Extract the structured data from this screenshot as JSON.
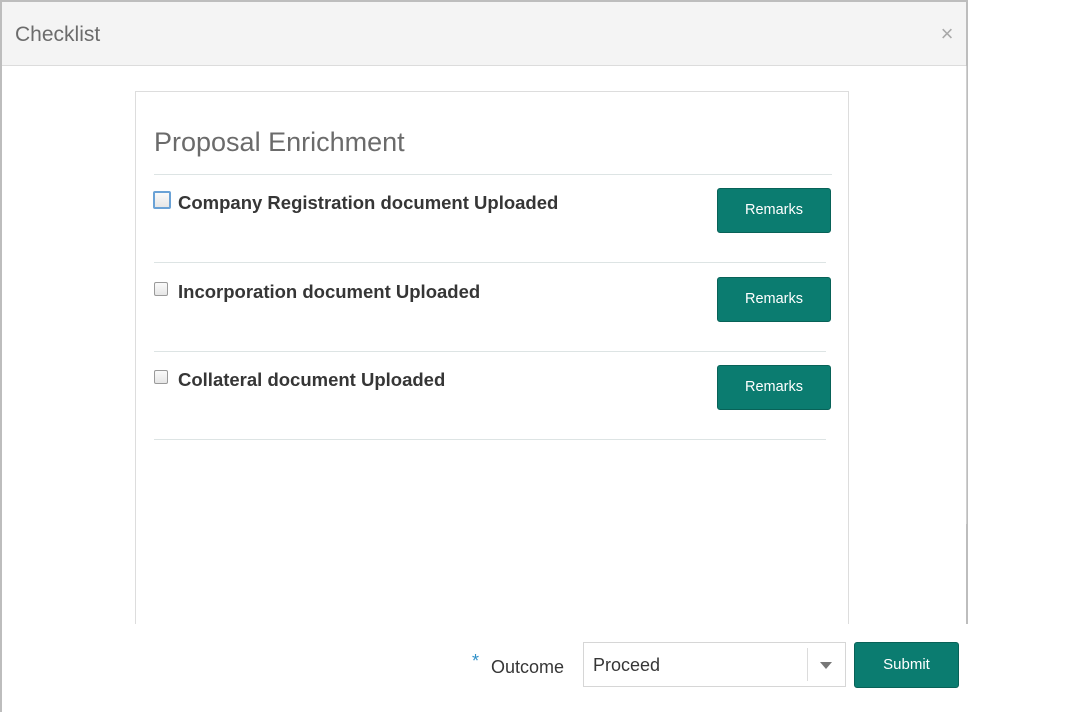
{
  "modal": {
    "title": "Checklist",
    "close_symbol": "×"
  },
  "checklist": {
    "section_title": "Proposal Enrichment",
    "items": [
      {
        "label": "Company Registration document Uploaded",
        "checked": false,
        "remarks_label": "Remarks"
      },
      {
        "label": "Incorporation document Uploaded",
        "checked": false,
        "remarks_label": "Remarks"
      },
      {
        "label": "Collateral document Uploaded",
        "checked": false,
        "remarks_label": "Remarks"
      }
    ]
  },
  "footer": {
    "required_marker": "*",
    "outcome_label": "Outcome",
    "outcome_value": "Proceed",
    "submit_label": "Submit"
  },
  "colors": {
    "accent": "#0b7c70",
    "required": "#2f90c8"
  },
  "icons": {
    "close": "close-icon",
    "dropdown": "chevron-down-icon"
  }
}
